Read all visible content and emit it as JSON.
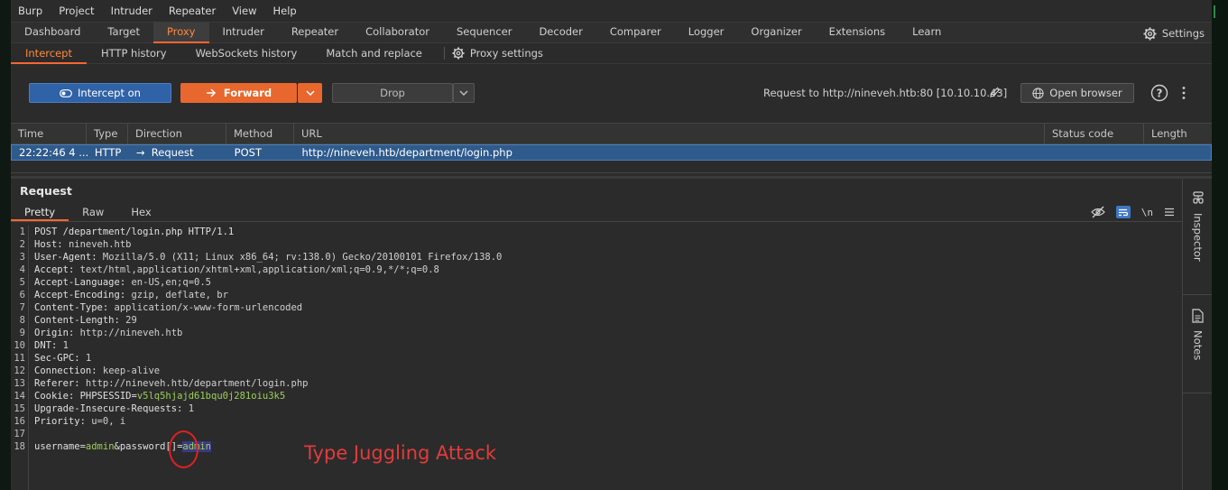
{
  "menu": [
    "Burp",
    "Project",
    "Intruder",
    "Repeater",
    "View",
    "Help"
  ],
  "main_tabs": [
    "Dashboard",
    "Target",
    "Proxy",
    "Intruder",
    "Repeater",
    "Collaborator",
    "Sequencer",
    "Decoder",
    "Comparer",
    "Logger",
    "Organizer",
    "Extensions",
    "Learn"
  ],
  "main_tab_active": "Proxy",
  "settings_label": "Settings",
  "sub_tabs": [
    "Intercept",
    "HTTP history",
    "WebSockets history",
    "Match and replace"
  ],
  "proxy_settings_label": "Proxy settings",
  "toolbar": {
    "intercept_label": "Intercept on",
    "forward_label": "Forward",
    "drop_label": "Drop",
    "request_info": "Request to http://nineveh.htb:80  [10.10.10.43]",
    "open_browser_label": "Open browser"
  },
  "table": {
    "headers": [
      "Time",
      "Type",
      "Direction",
      "Method",
      "URL",
      "Status code",
      "Length"
    ],
    "row": {
      "time": "22:22:46 4 ...",
      "type": "HTTP",
      "direction": "Request",
      "method": "POST",
      "url": "http://nineveh.htb/department/login.php",
      "status": "",
      "length": ""
    }
  },
  "request_panel": {
    "title": "Request",
    "tabs": [
      "Pretty",
      "Raw",
      "Hex"
    ]
  },
  "request_lines": {
    "l1": "POST /department/login.php HTTP/1.1",
    "l2k": "Host",
    "l2v": "nineveh.htb",
    "l3k": "User-Agent",
    "l3v": "Mozilla/5.0 (X11; Linux x86_64; rv:138.0) Gecko/20100101 Firefox/138.0",
    "l4k": "Accept",
    "l4v": "text/html,application/xhtml+xml,application/xml;q=0.9,*/*;q=0.8",
    "l5k": "Accept-Language",
    "l5v": "en-US,en;q=0.5",
    "l6k": "Accept-Encoding",
    "l6v": "gzip, deflate, br",
    "l7k": "Content-Type",
    "l7v": "application/x-www-form-urlencoded",
    "l8k": "Content-Length",
    "l8v": "29",
    "l9k": "Origin",
    "l9v": "http://nineveh.htb",
    "l10k": "DNT",
    "l10v": "1",
    "l11k": "Sec-GPC",
    "l11v": "1",
    "l12k": "Connection",
    "l12v": "keep-alive",
    "l13k": "Referer",
    "l13v": "http://nineveh.htb/department/login.php",
    "l14k": "Cookie",
    "l14name": "PHPSESSID",
    "l14val": "v5lq5hjajd61bqu0j281oiu3k5",
    "l15k": "Upgrade-Insecure-Requests",
    "l15v": "1",
    "l16k": "Priority",
    "l16v": "u=0, i",
    "body_k1": "username",
    "body_v1": "admin",
    "body_k2": "password[]",
    "body_v2": "admin"
  },
  "line_numbers": [
    "1",
    "2",
    "3",
    "4",
    "5",
    "6",
    "7",
    "8",
    "9",
    "10",
    "11",
    "12",
    "13",
    "14",
    "15",
    "16",
    "17",
    "18"
  ],
  "annotation": "Type Juggling Attack",
  "sidebar": {
    "inspector": "Inspector",
    "notes": "Notes"
  }
}
